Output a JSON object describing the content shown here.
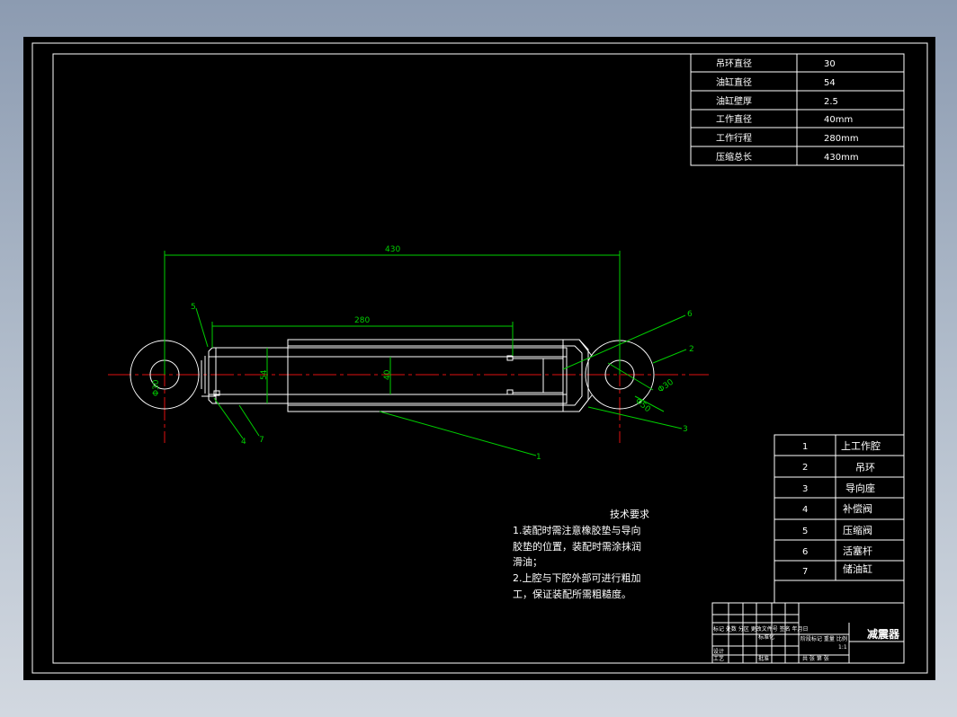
{
  "params": [
    {
      "label": "吊环直径",
      "value": "30"
    },
    {
      "label": "油缸直径",
      "value": "54"
    },
    {
      "label": "油缸壁厚",
      "value": "2.5"
    },
    {
      "label": "工作直径",
      "value": "40mm"
    },
    {
      "label": "工作行程",
      "value": "280mm"
    },
    {
      "label": "压缩总长",
      "value": "430mm"
    }
  ],
  "dimensions": {
    "overall": "430",
    "stroke": "280",
    "cyl_dia": "54",
    "piston_dia": "40",
    "eye_dia": "Φ30",
    "eye_outer": "Φ50"
  },
  "balloons": [
    "1",
    "2",
    "3",
    "4",
    "5",
    "6",
    "7"
  ],
  "parts": [
    {
      "no": "1",
      "name": "上工作腔"
    },
    {
      "no": "2",
      "name": "吊环"
    },
    {
      "no": "3",
      "name": "导向座"
    },
    {
      "no": "4",
      "name": "补偿阀"
    },
    {
      "no": "5",
      "name": "压缩阀"
    },
    {
      "no": "6",
      "name": "活塞杆"
    },
    {
      "no": "7",
      "name": "储油缸"
    }
  ],
  "tech": {
    "title": "技术要求",
    "lines": [
      "1.装配时需注意橡胶垫与导向",
      "胶垫的位置，装配时需涂抹润",
      "滑油；",
      "2.上腔与下腔外部可进行粗加",
      "工，保证装配所需粗糙度。"
    ]
  },
  "title_block": {
    "drawing_name": "减震器",
    "row1": "标记 处数 分区 更改文件号 签名 年月日",
    "row1b": "标准化",
    "row2": "阶段标记 重量 比例",
    "scale": "1:1",
    "row3": "共 张 第 张",
    "design": "设计",
    "review": "审核",
    "process": "工艺",
    "approve": "批准"
  }
}
